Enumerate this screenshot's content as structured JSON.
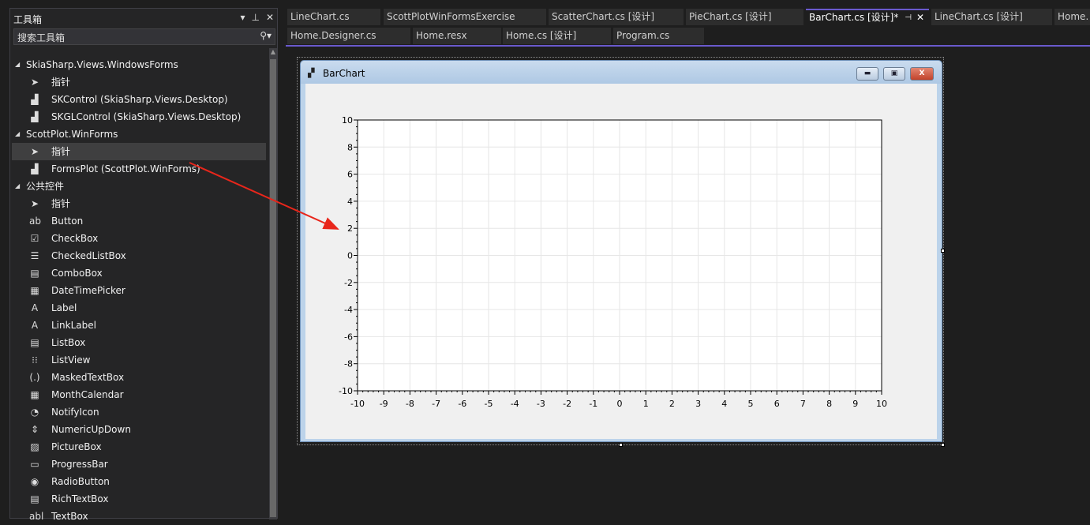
{
  "toolbox": {
    "title": "工具箱",
    "search_placeholder": "搜索工具箱",
    "groups": [
      {
        "name": "SkiaSharp.Views.WindowsForms",
        "items": [
          {
            "label": "指针",
            "icon": "pointer-icon"
          },
          {
            "label": "SKControl (SkiaSharp.Views.Desktop)",
            "icon": "component-icon"
          },
          {
            "label": "SKGLControl (SkiaSharp.Views.Desktop)",
            "icon": "component-icon"
          }
        ]
      },
      {
        "name": "ScottPlot.WinForms",
        "items": [
          {
            "label": "指针",
            "icon": "pointer-icon",
            "selected": true
          },
          {
            "label": "FormsPlot (ScottPlot.WinForms)",
            "icon": "component-icon"
          }
        ]
      },
      {
        "name": "公共控件",
        "items": [
          {
            "label": "指针",
            "icon": "pointer-icon"
          },
          {
            "label": "Button",
            "icon": "button-icon"
          },
          {
            "label": "CheckBox",
            "icon": "checkbox-icon"
          },
          {
            "label": "CheckedListBox",
            "icon": "checkedlistbox-icon"
          },
          {
            "label": "ComboBox",
            "icon": "combobox-icon"
          },
          {
            "label": "DateTimePicker",
            "icon": "datetimepicker-icon"
          },
          {
            "label": "Label",
            "icon": "label-icon"
          },
          {
            "label": "LinkLabel",
            "icon": "linklabel-icon"
          },
          {
            "label": "ListBox",
            "icon": "listbox-icon"
          },
          {
            "label": "ListView",
            "icon": "listview-icon"
          },
          {
            "label": "MaskedTextBox",
            "icon": "maskedtextbox-icon"
          },
          {
            "label": "MonthCalendar",
            "icon": "calendar-icon"
          },
          {
            "label": "NotifyIcon",
            "icon": "notifyicon-icon"
          },
          {
            "label": "NumericUpDown",
            "icon": "numericupdown-icon"
          },
          {
            "label": "PictureBox",
            "icon": "picturebox-icon"
          },
          {
            "label": "ProgressBar",
            "icon": "progressbar-icon"
          },
          {
            "label": "RadioButton",
            "icon": "radiobutton-icon"
          },
          {
            "label": "RichTextBox",
            "icon": "richtextbox-icon"
          },
          {
            "label": "TextBox",
            "icon": "textbox-icon"
          }
        ]
      }
    ]
  },
  "tabs_row1": [
    "LineChart.cs",
    "ScottPlotWinFormsExercise",
    "ScatterChart.cs [设计]",
    "PieChart.cs [设计]",
    "BarChart.cs [设计]*",
    "LineChart.cs [设计]",
    "Home."
  ],
  "tabs_row2": [
    "Home.Designer.cs",
    "Home.resx",
    "Home.cs [设计]",
    "Program.cs"
  ],
  "active_tab_index": 4,
  "accent_color": "#6a5acd",
  "form": {
    "title": "BarChart"
  },
  "chart_data": {
    "type": "bar",
    "title": "",
    "xlabel": "",
    "ylabel": "",
    "xlim": [
      -10,
      10
    ],
    "ylim": [
      -10,
      10
    ],
    "xticks": [
      "-10",
      "-9",
      "-8",
      "-7",
      "-6",
      "-5",
      "-4",
      "-3",
      "-2",
      "-1",
      "0",
      "1",
      "2",
      "3",
      "4",
      "5",
      "6",
      "7",
      "8",
      "9",
      "10"
    ],
    "yticks": [
      "10",
      "8",
      "6",
      "4",
      "2",
      "0",
      "-2",
      "-4",
      "-6",
      "-8",
      "-10"
    ],
    "grid": true,
    "series": []
  }
}
